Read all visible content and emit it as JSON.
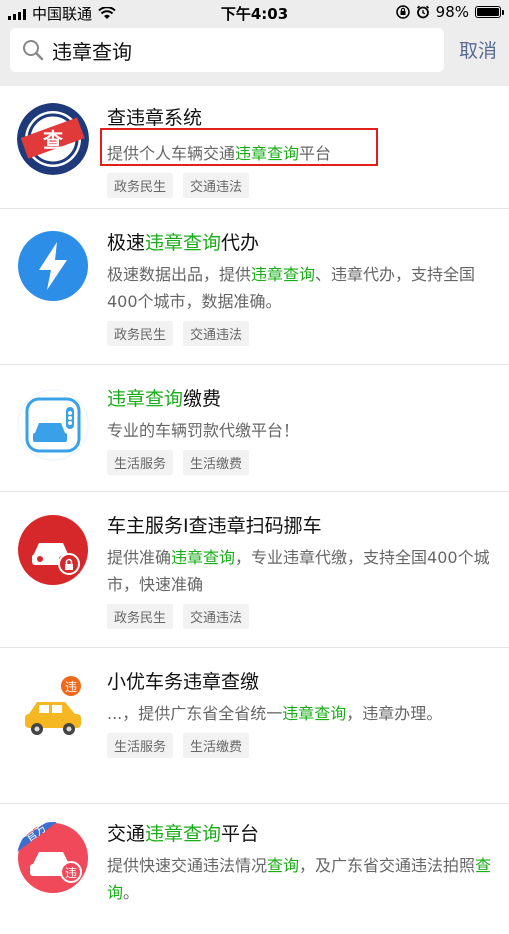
{
  "status_bar": {
    "carrier": "中国联通",
    "time": "下午4:03",
    "battery": "98%",
    "battery_level": 0.98
  },
  "search": {
    "query": "违章查询",
    "cancel_label": "取消"
  },
  "results": [
    {
      "title_parts": [
        "查违章系统"
      ],
      "desc_parts": [
        "提供个人车辆交通",
        "违章查询",
        "平台"
      ],
      "tags": [
        "政务民生",
        "交通违法"
      ],
      "logo_text": "查"
    },
    {
      "title_parts": [
        "极速",
        "违章查询",
        "代办"
      ],
      "desc_parts": [
        "极速数据出品，提供",
        "违章查询",
        "、违章代办，支持全国400个城市，数据准确。"
      ],
      "tags": [
        "政务民生",
        "交通违法"
      ]
    },
    {
      "title_parts": [
        "",
        "违章查询",
        "缴费"
      ],
      "desc_parts": [
        "专业的车辆罚款代缴平台！"
      ],
      "tags": [
        "生活服务",
        "生活缴费"
      ]
    },
    {
      "title_parts": [
        "车主服务I查违章扫码挪车"
      ],
      "desc_parts": [
        "提供准确",
        "违章查询",
        "，专业违章代缴，支持全国400个城市，快速准确"
      ],
      "tags": [
        "政务民生",
        "交通违法"
      ]
    },
    {
      "title_parts": [
        "小优车务违章查缴"
      ],
      "desc_parts": [
        "...，提供广东省全省统一",
        "违章查询",
        "，违章办理。"
      ],
      "tags": [
        "生活服务",
        "生活缴费"
      ],
      "logo_text": "违"
    },
    {
      "title_parts": [
        "交通",
        "违章查询",
        "平台"
      ],
      "desc_parts": [
        "提供快速交通违法情况",
        "查询",
        "，及广东省交通违法拍照",
        "查询",
        "。"
      ],
      "tags": [],
      "logo_badge": "官方",
      "logo_text": "违"
    }
  ],
  "colors": {
    "highlight": "#1aad19",
    "link_blue": "#576b95",
    "red_box": "#e0201b"
  },
  "icons": [
    "signal-icon",
    "wifi-icon",
    "search-icon",
    "alarm-icon",
    "lock-rotation-icon",
    "battery-icon"
  ]
}
